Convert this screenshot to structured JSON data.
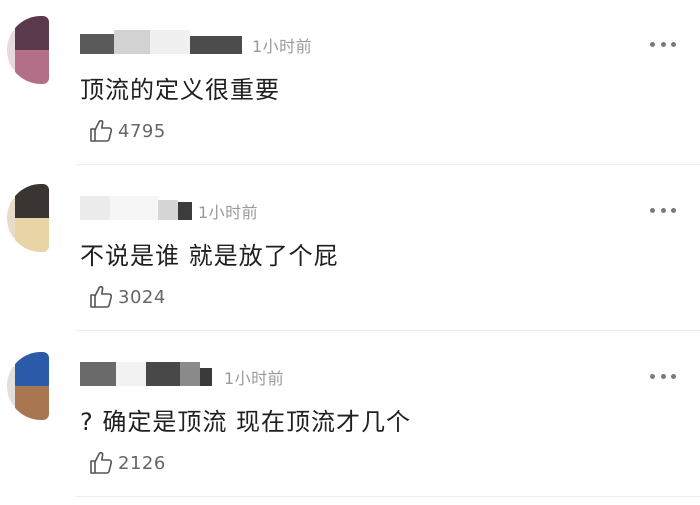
{
  "comments": [
    {
      "time": "1小时前",
      "text": "顶流的定义很重要",
      "likes": "4795"
    },
    {
      "time": "1小时前",
      "text": "不说是谁 就是放了个屁",
      "likes": "3024"
    },
    {
      "time": "1小时前",
      "text": "? 确定是顶流 现在顶流才几个",
      "likes": "2126"
    }
  ],
  "icons": {
    "like": "thumbs-up-icon",
    "more": "more-dots-icon"
  },
  "colors": {
    "text": "#1f1f1f",
    "muted": "#9a9a9a",
    "divider": "#ececec"
  }
}
